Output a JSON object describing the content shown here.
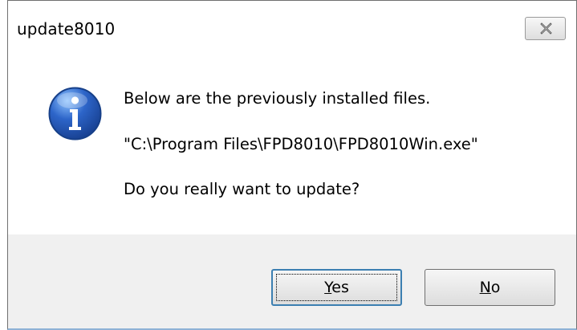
{
  "window": {
    "title": "update8010"
  },
  "title_controls": {
    "close_icon": "close-icon"
  },
  "dialog": {
    "icon": "info-icon",
    "message_line1": "Below are the previously installed files.",
    "message_line2": "\"C:\\Program Files\\FPD8010\\FPD8010Win.exe\"",
    "message_line3": "Do you really want to update?"
  },
  "buttons": {
    "yes": {
      "first": "Y",
      "rest": "es"
    },
    "no": {
      "first": "N",
      "rest": "o"
    }
  },
  "colors": {
    "accent": "#3c7fb1",
    "info_icon_blue": "#2d65c9"
  }
}
